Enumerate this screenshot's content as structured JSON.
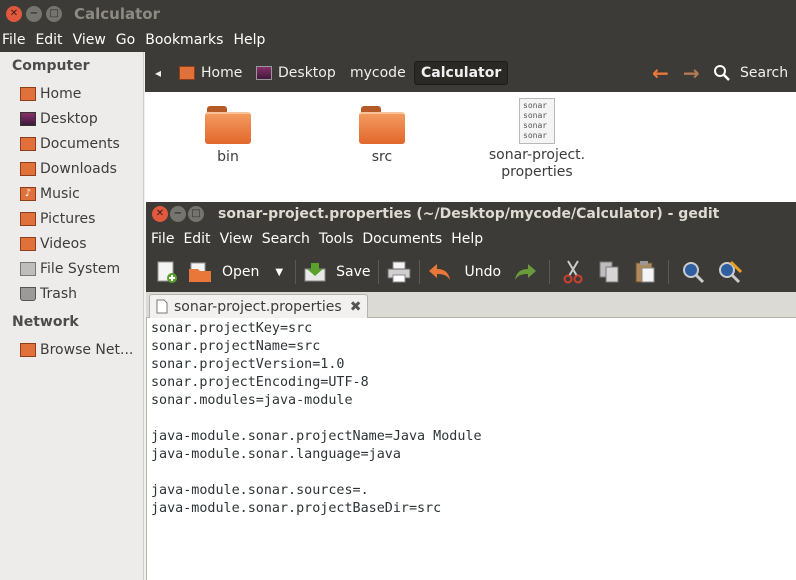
{
  "nautilus": {
    "title": "Calculator",
    "menu": [
      "File",
      "Edit",
      "View",
      "Go",
      "Bookmarks",
      "Help"
    ],
    "sidebar": {
      "computer_heading": "Computer",
      "computer_items": [
        "Home",
        "Desktop",
        "Documents",
        "Downloads",
        "Music",
        "Pictures",
        "Videos",
        "File System",
        "Trash"
      ],
      "network_heading": "Network",
      "network_items": [
        "Browse Net..."
      ]
    },
    "path": {
      "crumbs": [
        "Home",
        "Desktop",
        "mycode",
        "Calculator"
      ],
      "search_label": "Search"
    },
    "files": [
      {
        "name": "bin",
        "type": "folder"
      },
      {
        "name": "src",
        "type": "folder"
      },
      {
        "name": "sonar-project.\nproperties",
        "type": "text-file",
        "preview": [
          "sonar",
          "sonar",
          "sonar",
          "sonar"
        ]
      }
    ]
  },
  "gedit": {
    "title": "sonar-project.properties (~/Desktop/mycode/Calculator) - gedit",
    "menu": [
      "File",
      "Edit",
      "View",
      "Search",
      "Tools",
      "Documents",
      "Help"
    ],
    "toolbar": {
      "open": "Open",
      "save": "Save",
      "undo": "Undo"
    },
    "tab_label": "sonar-project.properties",
    "lines": [
      "sonar.projectKey=src",
      "sonar.projectName=src",
      "sonar.projectVersion=1.0",
      "sonar.projectEncoding=UTF-8",
      "sonar.modules=java-module",
      "",
      "java-module.sonar.projectName=Java Module",
      "java-module.sonar.language=java",
      "",
      "java-module.sonar.sources=.",
      "java-module.sonar.projectBaseDir=src"
    ]
  },
  "colors": {
    "titlebar": "#3c3b37",
    "close_button": "#e0593e",
    "folder_orange": "#e9773a",
    "nav_arrow": "#e9773a"
  }
}
